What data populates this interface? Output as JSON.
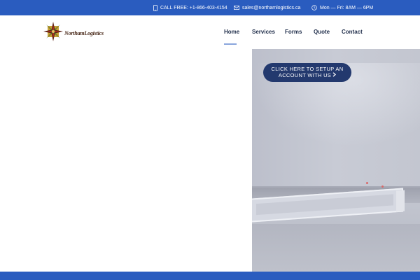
{
  "topbar": {
    "phone_text": "CALL FREE: +1-866-403-4154",
    "phone_icon": "phone-icon",
    "email_text": "sales@northamlogistics.ca",
    "email_icon": "mail-icon",
    "hours_text": "Mon — Fri: 8AM — 6PM",
    "hours_icon": "clock-icon"
  },
  "header": {
    "logo_text": "NorthamLogistics",
    "logo_icon": "compass-star-logo"
  },
  "nav": {
    "items": [
      {
        "label": "Home",
        "active": true
      },
      {
        "label": "Services"
      },
      {
        "label": "Forms"
      },
      {
        "label": "Quote"
      },
      {
        "label": "Contact"
      }
    ]
  },
  "hero": {
    "cta_line1": "CLICK HERE TO SETUP AN",
    "cta_line2": "ACCOUNT WITH US",
    "cta_icon": "chevron-right-icon"
  },
  "colors": {
    "brand_blue": "#2a5cbf",
    "cta_navy": "#23396e",
    "nav_text": "#1f2d4a",
    "active_underline": "#8aa6dc"
  }
}
